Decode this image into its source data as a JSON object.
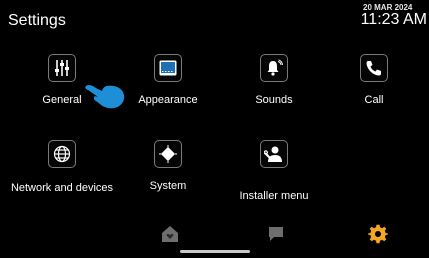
{
  "header": {
    "title": "Settings",
    "date": "20 MAR 2024",
    "time": "11:23 AM"
  },
  "tiles": [
    {
      "label": "General",
      "icon": "sliders-icon"
    },
    {
      "label": "Appearance",
      "icon": "display-icon"
    },
    {
      "label": "Sounds",
      "icon": "bell-icon"
    },
    {
      "label": "Call",
      "icon": "phone-icon"
    },
    {
      "label": "Network and devices",
      "icon": "globe-icon"
    },
    {
      "label": "System",
      "icon": "chip-icon"
    },
    {
      "label": "Installer menu",
      "icon": "installer-icon"
    }
  ],
  "bottom_nav": {
    "items": [
      "home-icon",
      "chat-icon",
      "gear-icon"
    ],
    "active": "gear-icon",
    "active_color": "#f5a623",
    "inactive_color": "#6e6e6e"
  },
  "overlay": {
    "icon": "pointing-hand-icon",
    "color": "#1e8fd6"
  }
}
